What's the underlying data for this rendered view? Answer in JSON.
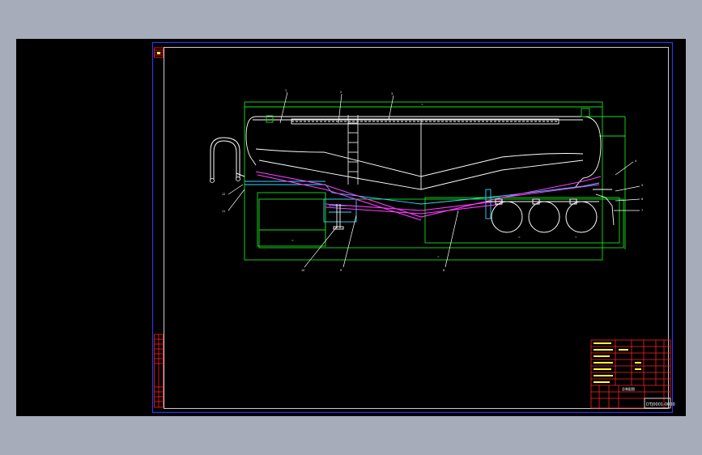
{
  "app": {
    "background": "#a6acb9",
    "canvas_background": "#000000"
  },
  "colors": {
    "frame": "#2a3ae6",
    "green": "#18e018",
    "white": "#ffffff",
    "magenta": "#ff3cff",
    "cyan": "#35d6ff",
    "red": "#ff2020",
    "yellow": "#ffff30"
  },
  "drawing": {
    "subject": "powder bulk cement tank semi-trailer side elevation",
    "title_block": {
      "drawing_code": "DTJ0001-0000",
      "drawing_label": "总装配图"
    },
    "callout_count": 12
  }
}
